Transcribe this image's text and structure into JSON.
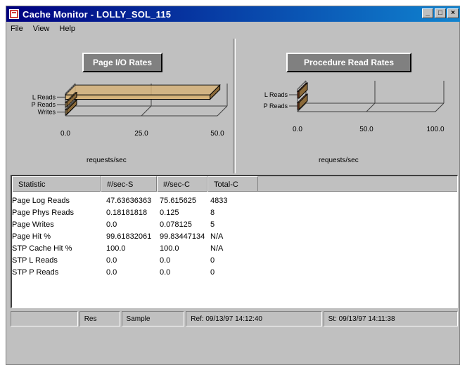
{
  "window": {
    "title": "Cache Monitor - LOLLY_SOL_115"
  },
  "titlebar_buttons": {
    "minimize": "_",
    "maximize": "□",
    "close": "×"
  },
  "menu": {
    "items": [
      "File",
      "View",
      "Help"
    ]
  },
  "charts": [
    {
      "title": "Page I/O Rates",
      "xlabel": "requests/sec",
      "chart_data": {
        "type": "bar",
        "orientation": "horizontal",
        "categories": [
          "L Reads",
          "P Reads",
          "Writes"
        ],
        "values": [
          47.6,
          0.18,
          0.0
        ],
        "xlim": [
          0,
          50
        ],
        "ticks": [
          "0.0",
          "25.0",
          "50.0"
        ],
        "bar_color": "#d6b37a"
      }
    },
    {
      "title": "Procedure Read Rates",
      "xlabel": "requests/sec",
      "chart_data": {
        "type": "bar",
        "orientation": "horizontal",
        "categories": [
          "L Reads",
          "P Reads"
        ],
        "values": [
          0.0,
          0.0
        ],
        "xlim": [
          0,
          100
        ],
        "ticks": [
          "0.0",
          "50.0",
          "100.0"
        ],
        "bar_color": "#a0522d"
      }
    }
  ],
  "table": {
    "columns": [
      "Statistic",
      "#/sec-S",
      "#/sec-C",
      "Total-C"
    ],
    "rows": [
      [
        "Page Log Reads",
        "47.63636363",
        "75.615625",
        "4833"
      ],
      [
        "Page Phys Reads",
        "0.18181818",
        "0.125",
        "8"
      ],
      [
        "Page Writes",
        "0.0",
        "0.078125",
        "5"
      ],
      [
        "Page Hit %",
        "99.61832061",
        "99.83447134",
        "N/A"
      ],
      [
        "STP Cache Hit %",
        "100.0",
        "100.0",
        "N/A"
      ],
      [
        "STP L Reads",
        "0.0",
        "0.0",
        "0"
      ],
      [
        "STP P Reads",
        "0.0",
        "0.0",
        "0"
      ]
    ]
  },
  "status": {
    "cell1": "",
    "cell2": "Res",
    "cell3": "Sample",
    "cell4": "Ref: 09/13/97 14:12:40",
    "cell5": "St: 09/13/97 14:11:38"
  }
}
